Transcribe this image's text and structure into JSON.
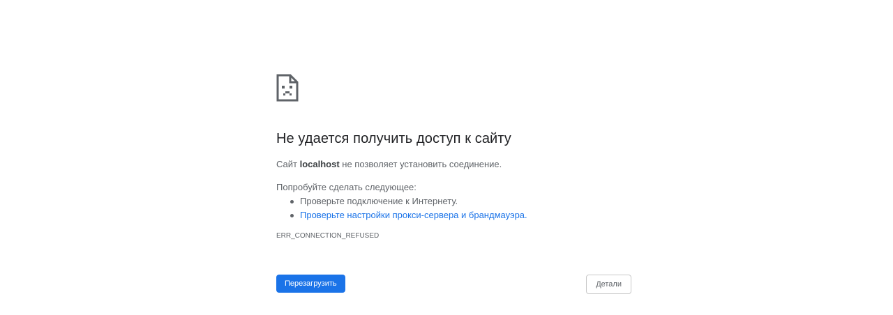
{
  "error_page": {
    "icon": "sad-document-icon",
    "title": "Не удается получить доступ к сайту",
    "summary": {
      "prefix": "Сайт ",
      "host": "localhost",
      "suffix": " не позволяет установить соединение."
    },
    "suggestions_heading": "Попробуйте сделать следующее:",
    "suggestions": [
      {
        "text": "Проверьте подключение к Интернету.",
        "is_link": false
      },
      {
        "text": "Проверьте настройки прокси-сервера и брандмауэра.",
        "is_link": true
      }
    ],
    "error_code": "ERR_CONNECTION_REFUSED",
    "buttons": {
      "reload": "Перезагрузить",
      "details": "Детали"
    },
    "colors": {
      "accent": "#1a73e8",
      "text": "#5f6368",
      "title": "#202124"
    }
  }
}
